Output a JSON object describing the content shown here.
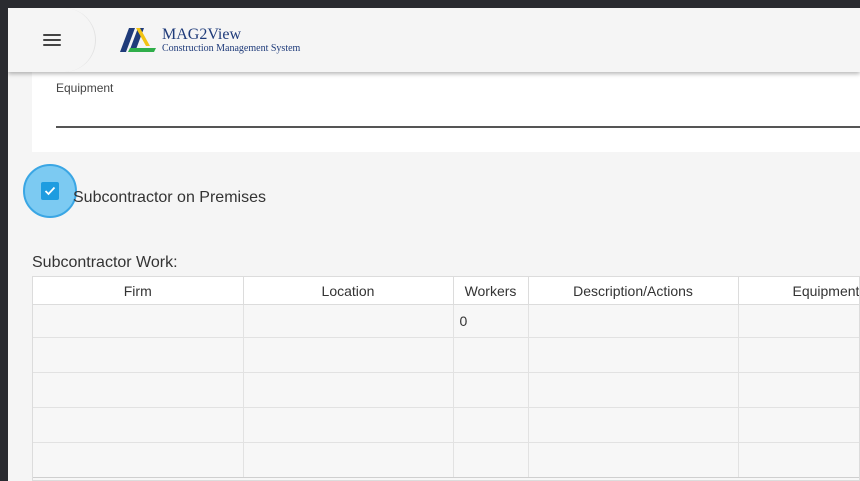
{
  "app": {
    "title": "MAG2View",
    "subtitle": "Construction Management System",
    "menu_icon": "hamburger-menu-icon",
    "logo_colors": {
      "navy": "#1f3b7a",
      "yellow": "#f2c313",
      "green": "#2fae4a"
    }
  },
  "equipment": {
    "label": "Equipment",
    "value": ""
  },
  "subcontractor_checkbox": {
    "label": "Subcontractor on Premises",
    "checked": true,
    "accent": "#1e9ce0"
  },
  "subcontractor_work": {
    "title": "Subcontractor Work:",
    "columns": [
      "Firm",
      "Location",
      "Workers",
      "Description/Actions",
      "Equipment"
    ],
    "rows": [
      [
        "",
        "",
        "0",
        "",
        ""
      ],
      [
        "",
        "",
        "",
        "",
        ""
      ],
      [
        "",
        "",
        "",
        "",
        ""
      ],
      [
        "",
        "",
        "",
        "",
        ""
      ],
      [
        "",
        "",
        "",
        "",
        ""
      ]
    ]
  }
}
